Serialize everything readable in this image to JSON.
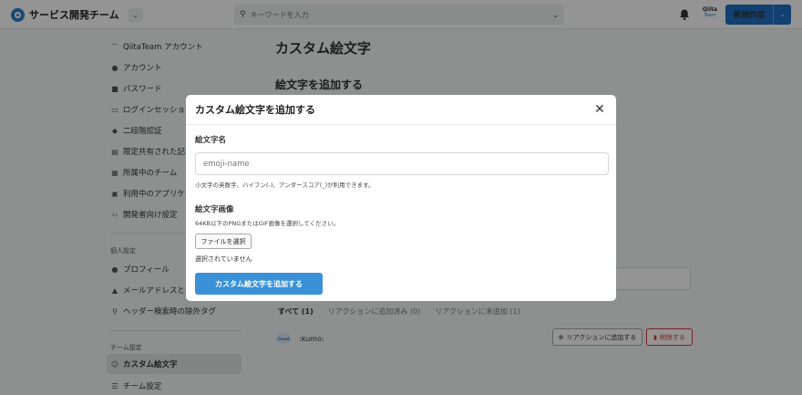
{
  "header": {
    "team_name": "サービス開発チーム",
    "search_placeholder": "キーワードを入力",
    "qiita_team_logo_line1": "Qiita",
    "qiita_team_logo_line2": "Team",
    "new_post_label": "新規作成"
  },
  "sidebar": {
    "items_account": [
      {
        "icon": "qiitateam-icon",
        "label": "QiitaTeam アカウント"
      },
      {
        "icon": "user-icon",
        "label": "アカウント"
      },
      {
        "icon": "lock-icon",
        "label": "パスワード"
      },
      {
        "icon": "session-icon",
        "label": "ログインセッション"
      },
      {
        "icon": "shield-icon",
        "label": "二段階認証"
      },
      {
        "icon": "doc-icon",
        "label": "限定共有された記事"
      },
      {
        "icon": "team-icon",
        "label": "所属中のチーム"
      },
      {
        "icon": "apps-icon",
        "label": "利用中のアプリケー"
      },
      {
        "icon": "code-icon",
        "label": "開発者向け設定"
      }
    ],
    "personal_heading": "個人設定",
    "items_personal": [
      {
        "icon": "user-icon",
        "label": "プロフィール"
      },
      {
        "icon": "bell-icon",
        "label": "メールアドレスと通"
      },
      {
        "icon": "search-icon",
        "label": "ヘッダー検索時の除外タグ"
      }
    ],
    "team_heading": "チーム設定",
    "items_team": [
      {
        "icon": "emoji-icon",
        "label": "カスタム絵文字"
      },
      {
        "icon": "settings-icon",
        "label": "チーム設定"
      }
    ]
  },
  "main": {
    "page_title": "カスタム絵文字",
    "add_section_title": "絵文字を追加する",
    "filter_tabs": [
      "すべて (1)",
      "リアクションに追加済み (0)",
      "リアクションに未追加 (1)"
    ],
    "emoji_row": {
      "image_text": "Cloud",
      "code": ":kumo:",
      "add_reaction_label": "リアクションに追加する",
      "delete_label": "削除する"
    }
  },
  "modal": {
    "title": "カスタム絵文字を追加する",
    "name_label": "絵文字名",
    "name_placeholder": "emoji-name",
    "name_help": "小文字の英数字、ハイフン(-)、アンダースコア(_)が利用できます。",
    "image_label": "絵文字画像",
    "image_help": "64KB以下のPNGまたはGIF画像を選択してください。",
    "file_button": "ファイルを選択",
    "no_file": "選択されていません",
    "submit": "カスタム絵文字を追加する"
  }
}
